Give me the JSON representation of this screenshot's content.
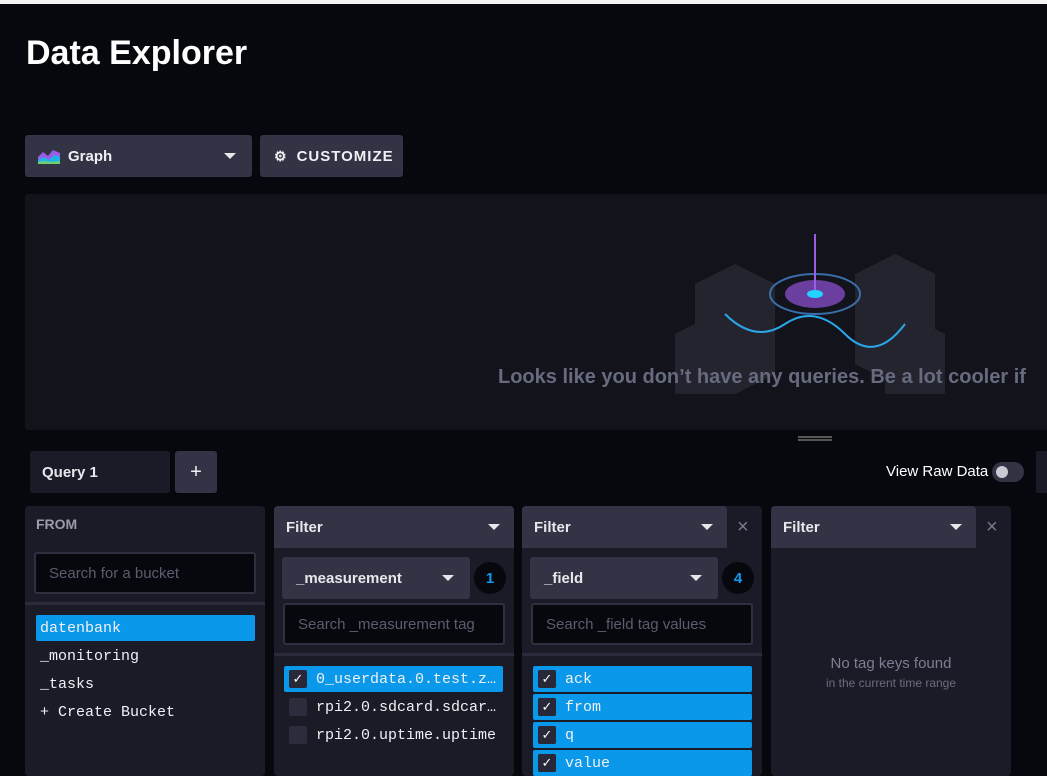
{
  "page": {
    "title": "Data Explorer"
  },
  "toolbar": {
    "graph_label": "Graph",
    "customize_label": "CUSTOMIZE"
  },
  "graph": {
    "empty_message": "Looks like you don’t have any queries. Be a lot cooler if"
  },
  "queries": {
    "tab": "Query 1",
    "add": "+",
    "raw_toggle_label": "View Raw Data",
    "raw_toggle_on": false
  },
  "from": {
    "title": "FROM",
    "search_placeholder": "Search for a bucket",
    "buckets": [
      {
        "name": "datenbank",
        "selected": true
      },
      {
        "name": "_monitoring",
        "selected": false
      },
      {
        "name": "_tasks",
        "selected": false
      }
    ],
    "create": "+ Create Bucket"
  },
  "filters": [
    {
      "title": "Filter",
      "key": "_measurement",
      "count": "1",
      "search_placeholder": "Search _measurement tag",
      "values": [
        {
          "name": "0_userdata.0.test.z…",
          "checked": true
        },
        {
          "name": "rpi2.0.sdcard.sdcar…",
          "checked": false
        },
        {
          "name": "rpi2.0.uptime.uptime",
          "checked": false
        }
      ]
    },
    {
      "title": "Filter",
      "key": "_field",
      "count": "4",
      "search_placeholder": "Search _field tag values",
      "values": [
        {
          "name": "ack",
          "checked": true
        },
        {
          "name": "from",
          "checked": true
        },
        {
          "name": "q",
          "checked": true
        },
        {
          "name": "value",
          "checked": true
        }
      ]
    },
    {
      "title": "Filter",
      "empty_title": "No tag keys found",
      "empty_sub": "in the current time range"
    }
  ],
  "icons": {
    "close": "×",
    "check": "✓"
  }
}
